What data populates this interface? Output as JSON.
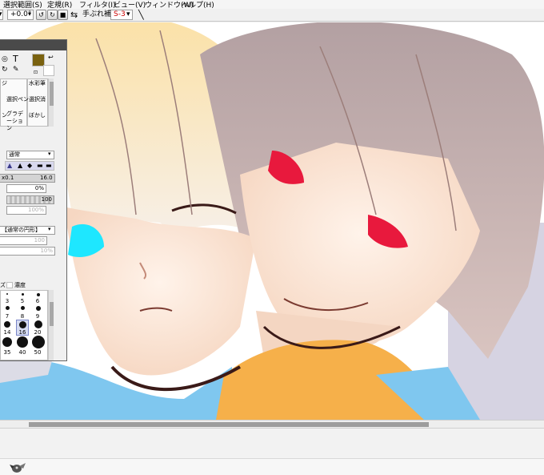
{
  "menu": {
    "items": [
      "選択範囲(S)",
      "定規(R)",
      "フィルタ(I)",
      "ビュー(V)",
      "ウィンドウ(W)",
      "ヘルプ(H)"
    ]
  },
  "toolbar": {
    "rotation_value": "+0.0°",
    "stabilizer_label": "手ぶれ補正",
    "stabilizer_value": "S-3"
  },
  "tool_panel": {
    "header_color": "#4a4a4a",
    "main_color": "#7a6210",
    "tools": [
      "ジ",
      "水彩筆",
      "選択ペン",
      "選択消",
      "ン",
      "グラデーション",
      "ぼかし"
    ],
    "blend_mode": "通常",
    "size_multiplier": "x0.1",
    "size_value": "16.0",
    "min_size": "0%",
    "density": "100",
    "density_faded": "100%",
    "brush_shape": "【通常の円形】",
    "shape_value_1": "100",
    "shape_value_2": "10%",
    "density_checkbox_label": "濃度",
    "brush_sizes": [
      "3",
      "5",
      "6",
      "7",
      "8",
      "9",
      "14",
      "16",
      "20",
      "35",
      "40",
      "50"
    ]
  },
  "status": {
    "app_icon": "paint-tool-sai-icon"
  },
  "colors": {
    "stabilizer_text": "#cc0000",
    "canvas_shadow": "#8fb2d8",
    "hair_light": "#efd7a5",
    "hair_dark": "#b79a98",
    "skin": "#fbe6d4",
    "eye_blue": "#1ee7ff",
    "eye_red": "#e8193d",
    "cloth_orange": "#f6b04a",
    "cloth_blue": "#7fc7ef"
  }
}
